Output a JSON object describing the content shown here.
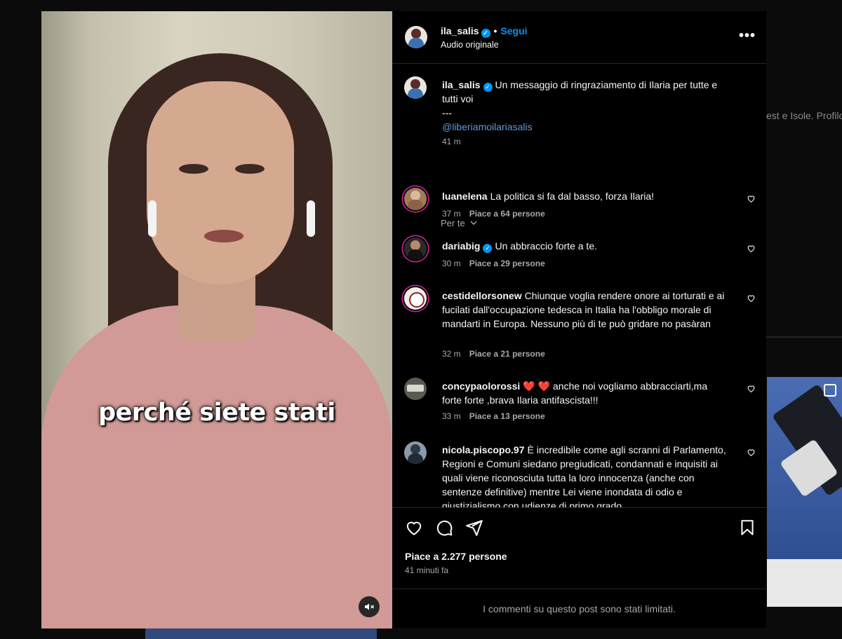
{
  "background": {
    "side_text": "est e Isole. Profilo"
  },
  "video": {
    "caption": "perché siete stati",
    "mute_icon": "speaker-muted-icon"
  },
  "post": {
    "username": "ila_salis",
    "follow_label": "Segui",
    "audio_label": "Audio originale",
    "more_icon": "more-horizontal-icon"
  },
  "description": {
    "username": "ila_salis",
    "text": "Un messaggio di ringraziamento di Ilaria per tutte e tutti voi",
    "separator": "---",
    "mention": "@liberiamoilariasalis",
    "time": "41 m"
  },
  "sort_label": "Per te",
  "comments": [
    {
      "username": "luanelena",
      "text": "La politica si fa dal basso, forza Ilaria!",
      "time": "37 m",
      "likes": "Piace a 64 persone"
    },
    {
      "username": "dariabig",
      "text": "Un abbraccio forte a te.",
      "time": "30 m",
      "likes": "Piace a 29 persone"
    },
    {
      "username": "cestidellorsonew",
      "text": "Chiunque voglia rendere onore ai torturati e ai fucilati dall'occupazione tedesca in Italia ha l'obbligo morale di mandarti in Europa. Nessuno più di te può gridare no pasàran",
      "time": "32 m",
      "likes": "Piace a 21 persone"
    },
    {
      "username": "concypaolorossi",
      "text": "❤️ ❤️ anche noi vogliamo abbracciarti,ma forte forte ,brava Ilaria antifascista!!!",
      "time": "33 m",
      "likes": "Piace a 13 persone"
    },
    {
      "username": "nicola.piscopo.97",
      "text": "È incredibile come agli scranni di Parlamento, Regioni e Comuni siedano pregiudicati, condannati e inquisiti ai quali viene riconosciuta tutta la loro innocenza (anche con sentenze definitive) mentre Lei viene inondata di odio e giustizialismo con udienze di primo grado",
      "time": "",
      "likes": ""
    }
  ],
  "footer": {
    "likes_total": "Piace a 2.277 persone",
    "posted": "41 minuti fa",
    "limited_notice": "I commenti su questo post sono stati limitati."
  },
  "colors": {
    "accent": "#0095f6",
    "background": "#000000",
    "muted_text": "#a8a8a8"
  }
}
